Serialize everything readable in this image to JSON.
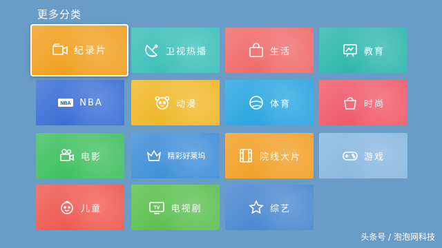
{
  "page_title": "更多分类",
  "watermark": "头条号 / 泡泡网科技",
  "focused_index": 0,
  "tiles": [
    {
      "label": "纪录片",
      "icon": "video-camera-icon",
      "color": "#f0a020"
    },
    {
      "label": "卫视热播",
      "icon": "satellite-dish-icon",
      "color": "#3cc0b8"
    },
    {
      "label": "生活",
      "icon": "shopping-bag-icon",
      "color": "#f06a6a"
    },
    {
      "label": "教育",
      "icon": "blackboard-icon",
      "color": "#2fb7ac"
    },
    {
      "label": "NBA",
      "icon": "nba-logo-icon",
      "color": "#3b6fd6"
    },
    {
      "label": "动漫",
      "icon": "panda-face-icon",
      "color": "#f0b828"
    },
    {
      "label": "体育",
      "icon": "ball-icon",
      "color": "#2aa6e0"
    },
    {
      "label": "时尚",
      "icon": "handbag-icon",
      "color": "#f05a6a"
    },
    {
      "label": "电影",
      "icon": "film-camera-icon",
      "color": "#40c060"
    },
    {
      "label": "精彩好莱坞",
      "icon": "crown-icon",
      "color": "#3f8fd8"
    },
    {
      "label": "院线大片",
      "icon": "film-strip-icon",
      "color": "#f2a028"
    },
    {
      "label": "游戏",
      "icon": "gamepad-icon",
      "color": "#8ab8e0"
    },
    {
      "label": "儿童",
      "icon": "child-face-icon",
      "color": "#ef5a50"
    },
    {
      "label": "电视剧",
      "icon": "tv-icon",
      "color": "#5cc050"
    },
    {
      "label": "综艺",
      "icon": "star-icon",
      "color": "#4a88d0"
    }
  ]
}
